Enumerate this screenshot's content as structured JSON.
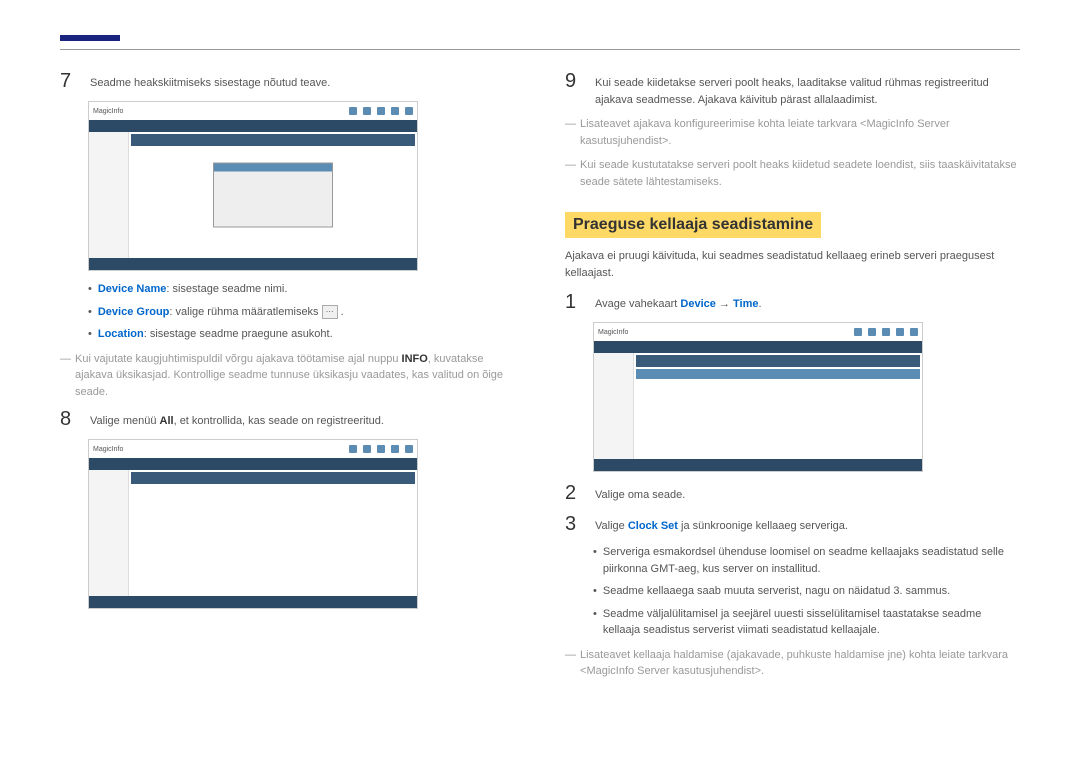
{
  "left": {
    "step7": "Seadme heakskiitmiseks sisestage nõutud teave.",
    "bullets7": {
      "b1_label": "Device Name",
      "b1_text": ": sisestage seadme nimi.",
      "b2_label": "Device Group",
      "b2_text": ": valige rühma määratlemiseks ",
      "b2_after": " .",
      "b3_label": "Location",
      "b3_text": ": sisestage seadme praegune asukoht."
    },
    "note7_pre": "Kui vajutate kaugjuhtimispuldil võrgu ajakava töötamise ajal nuppu ",
    "note7_bold": "INFO",
    "note7_post": ", kuvatakse ajakava üksikasjad. Kontrollige seadme tunnuse üksikasju vaadates, kas valitud on õige seade.",
    "step8_pre": "Valige menüü ",
    "step8_bold": "All",
    "step8_post": ", et kontrollida, kas seade on registreeritud."
  },
  "right": {
    "step9": "Kui seade kiidetakse serveri poolt heaks, laaditakse valitud rühmas registreeritud ajakava seadmesse. Ajakava käivitub pärast allalaadimist.",
    "note9a_pre": "Lisateavet ajakava konfigureerimise kohta leiate tarkvara <",
    "note9a_mid": "MagicInfo Server ",
    "note9a_post": "kasutusjuhendist>.",
    "note9b": "Kui seade kustutatakse serveri poolt heaks kiidetud seadete loendist, siis taaskäivitatakse seade sätete lähtestamiseks.",
    "heading": "Praeguse kellaaja seadistamine",
    "intro": "Ajakava ei pruugi käivituda, kui seadmes seadistatud kellaaeg erineb serveri praegusest kellaajast.",
    "step1_pre": "Avage vahekaart ",
    "step1_b1": "Device",
    "step1_arrow": " → ",
    "step1_b2": "Time",
    "step1_post": ".",
    "step2": "Valige oma seade.",
    "step3_pre": "Valige ",
    "step3_b": "Clock Set",
    "step3_post": " ja sünkroonige kellaaeg serveriga.",
    "bullets3": {
      "b1": "Serveriga esmakordsel ühenduse loomisel on seadme kellaajaks seadistatud selle piirkonna GMT-aeg, kus server on installitud.",
      "b2": "Seadme kellaaega saab muuta serverist, nagu on näidatud 3. sammus.",
      "b3": "Seadme väljalülitamisel ja seejärel uuesti sisselülitamisel taastatakse seadme kellaaja seadistus serverist viimati seadistatud kellaajale."
    },
    "note_end_pre": "Lisateavet kellaaja haldamise (ajakavade, puhkuste haldamise jne) kohta leiate tarkvara <",
    "note_end_mid": "MagicInfo Server ",
    "note_end_post": "kasutusjuhendist>."
  },
  "shot": {
    "logo": "MagicInfo"
  }
}
